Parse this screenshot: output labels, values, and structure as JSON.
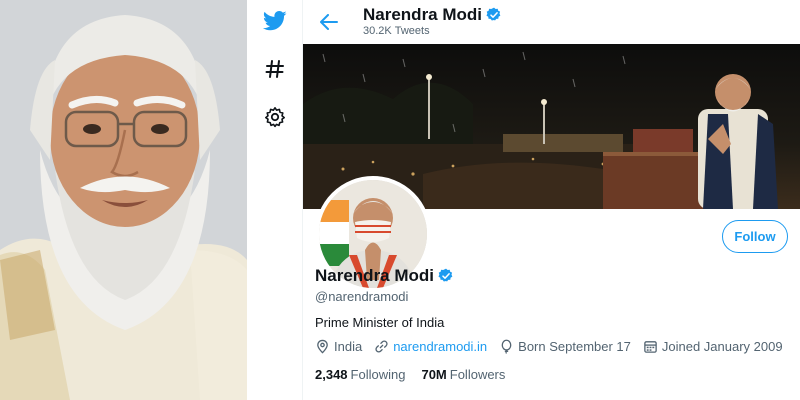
{
  "profile": {
    "name": "Narendra Modi",
    "tweet_count": "30.2K",
    "tweet_label": "Tweets",
    "handle": "@narendramodi",
    "bio": "Prime Minister of India",
    "location": "India",
    "website": "narendramodi.in",
    "born": "Born September 17",
    "joined": "Joined January 2009",
    "following_count": "2,348",
    "following_label": "Following",
    "followers_count": "70M",
    "followers_label": "Followers",
    "verified": true
  },
  "actions": {
    "follow_label": "Follow"
  },
  "nav": {
    "icons": [
      "twitter-logo-icon",
      "explore-hashtag-icon",
      "settings-gear-icon"
    ]
  },
  "colors": {
    "accent": "#1d9bf0",
    "text_primary": "#0f1419",
    "text_secondary": "#536471"
  }
}
